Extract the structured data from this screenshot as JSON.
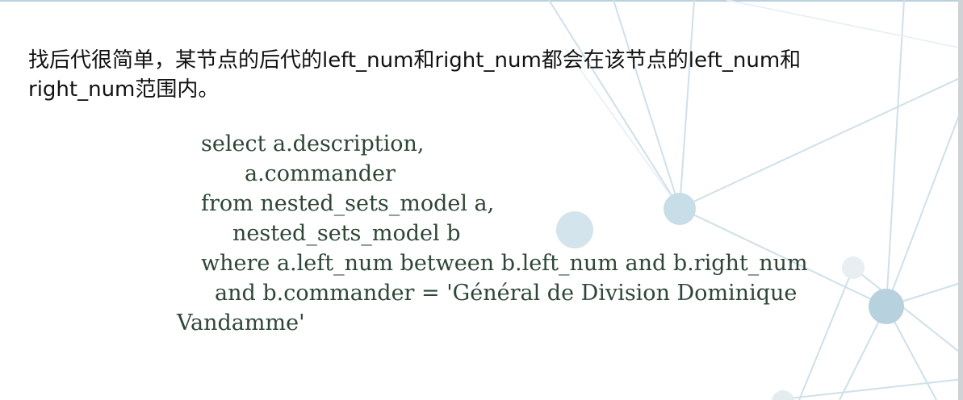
{
  "slide": {
    "intro_line_1": "找后代很简单，某节点的后代的left_num和right_num都会在该节点的left_num和",
    "intro_line_2": "right_num范围内。",
    "code_lines": [
      "select a.description,",
      "a.commander",
      "from nested_sets_model a,",
      "nested_sets_model b",
      "where a.left_num between b.left_num and b.right_num",
      "and b.commander = 'Général de Division Dominique",
      "Vandamme'"
    ]
  },
  "colors": {
    "code_text": "#2d4636",
    "body_text": "#111111",
    "network_line": "#c9dce6",
    "node": "#a9c9d8"
  }
}
